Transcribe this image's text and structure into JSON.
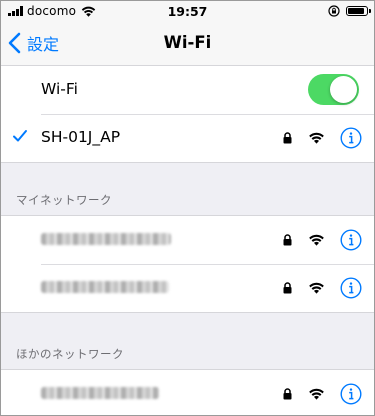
{
  "status_bar": {
    "carrier": "docomo",
    "time": "19:57",
    "battery_level": 0.9
  },
  "nav": {
    "back_label": "設定",
    "title": "Wi-Fi"
  },
  "wifi_toggle": {
    "label": "Wi-Fi",
    "on": true
  },
  "connected_network": {
    "name": "SH-01J_AP",
    "secured": true
  },
  "my_networks": {
    "header": "マイネットワーク",
    "items": [
      {
        "name_obscured": true,
        "secured": true
      },
      {
        "name_obscured": true,
        "secured": true
      }
    ]
  },
  "other_networks": {
    "header": "ほかのネットワーク",
    "items": [
      {
        "name_obscured": true,
        "secured": true
      }
    ]
  },
  "icons": {
    "checkmark": "checkmark-icon",
    "lock": "lock-icon",
    "wifi": "wifi-signal-icon",
    "info": "info-icon"
  },
  "colors": {
    "accent": "#007aff",
    "toggle_on": "#4cd964",
    "background": "#efeff4"
  }
}
